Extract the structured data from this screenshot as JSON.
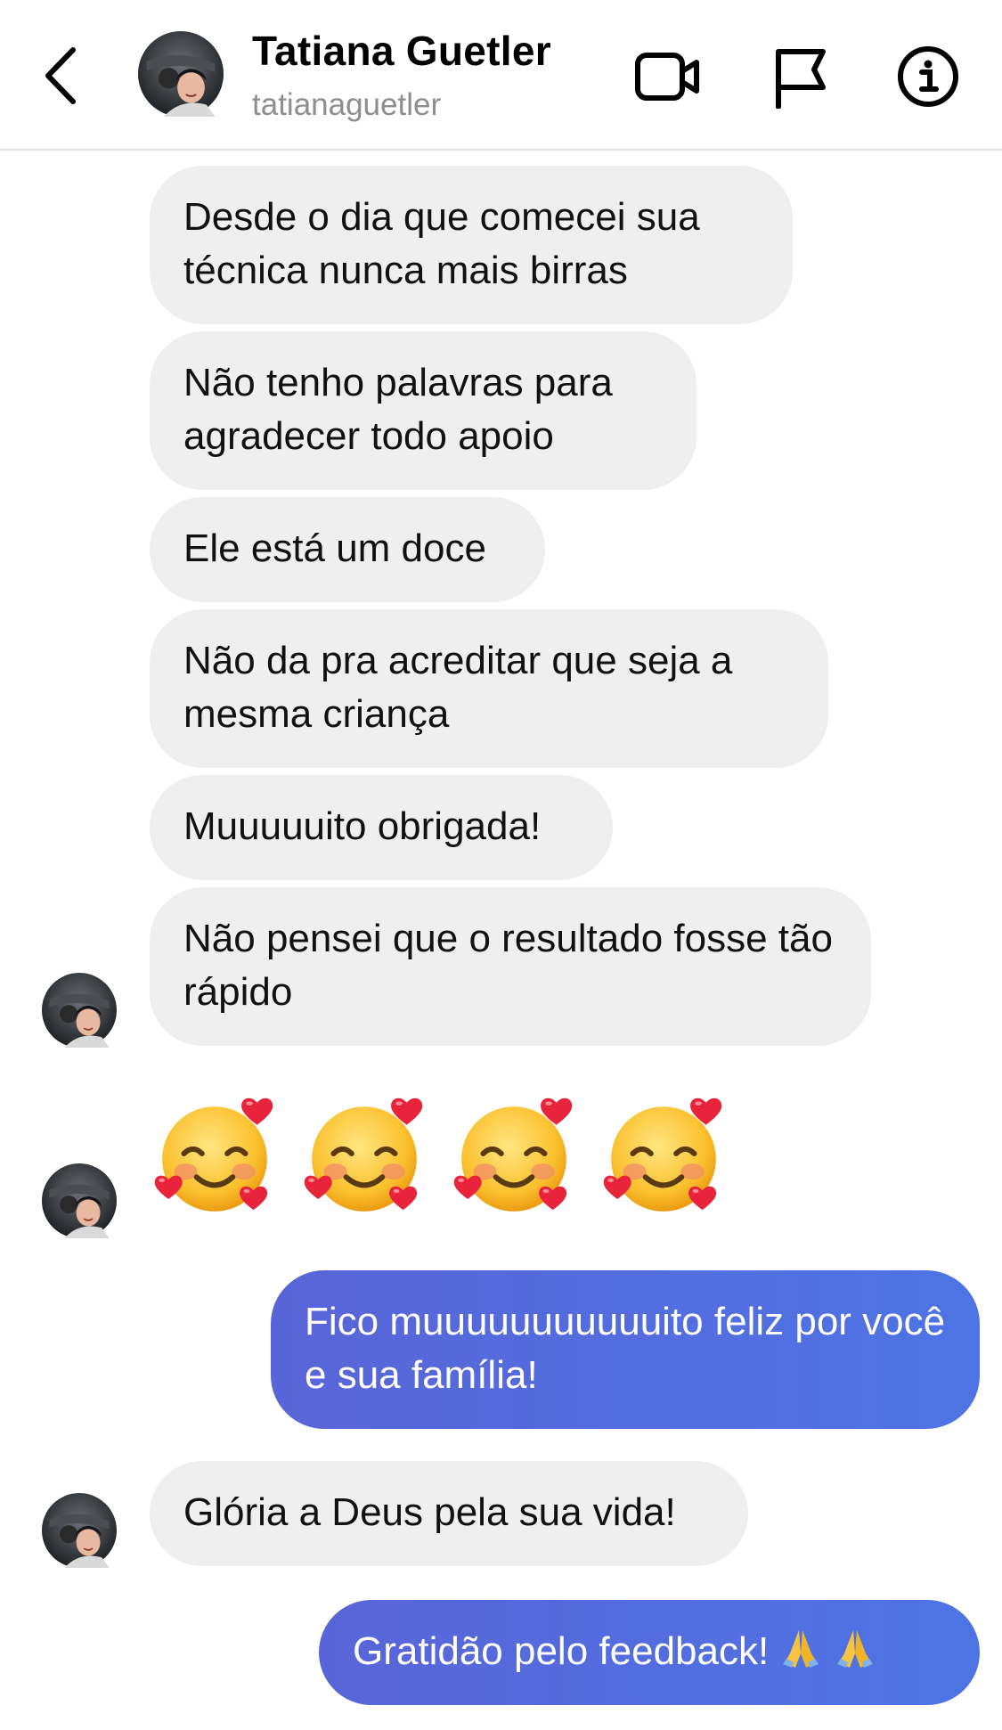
{
  "header": {
    "name": "Tatiana Guetler",
    "username": "tatianaguetler",
    "icons": [
      "back-chevron-icon",
      "video-call-icon",
      "flag-icon",
      "info-icon"
    ]
  },
  "messages": [
    {
      "side": "in",
      "text": "Desde o dia que comecei sua técnica nunca mais birras"
    },
    {
      "side": "in",
      "text": "Não tenho palavras para agradecer todo apoio"
    },
    {
      "side": "in",
      "text": "Ele está um doce"
    },
    {
      "side": "in",
      "text": "Não da pra acreditar que seja a mesma criança"
    },
    {
      "side": "in",
      "text": "Muuuuuito obrigada!"
    },
    {
      "side": "in",
      "text": "Não pensei que o resultado fosse tão rápido"
    },
    {
      "side": "in",
      "type": "emoji",
      "emoji": [
        "smiling-face-with-hearts-emoji",
        "smiling-face-with-hearts-emoji",
        "smiling-face-with-hearts-emoji",
        "smiling-face-with-hearts-emoji"
      ]
    },
    {
      "side": "out",
      "text": "Fico muuuuuuuuuuuito feliz por você e sua família!"
    },
    {
      "side": "in",
      "text": "Glória a Deus pela sua vida!"
    },
    {
      "side": "out",
      "text": "Gratidão pelo feedback!",
      "emoji": [
        "folded-hands-emoji",
        "folded-hands-emoji"
      ]
    }
  ],
  "colors": {
    "incoming_bubble": "#efefef",
    "outgoing_bubble_start": "#5865d8",
    "outgoing_bubble_end": "#4e74e4",
    "username_gray": "#8e8e8e"
  }
}
